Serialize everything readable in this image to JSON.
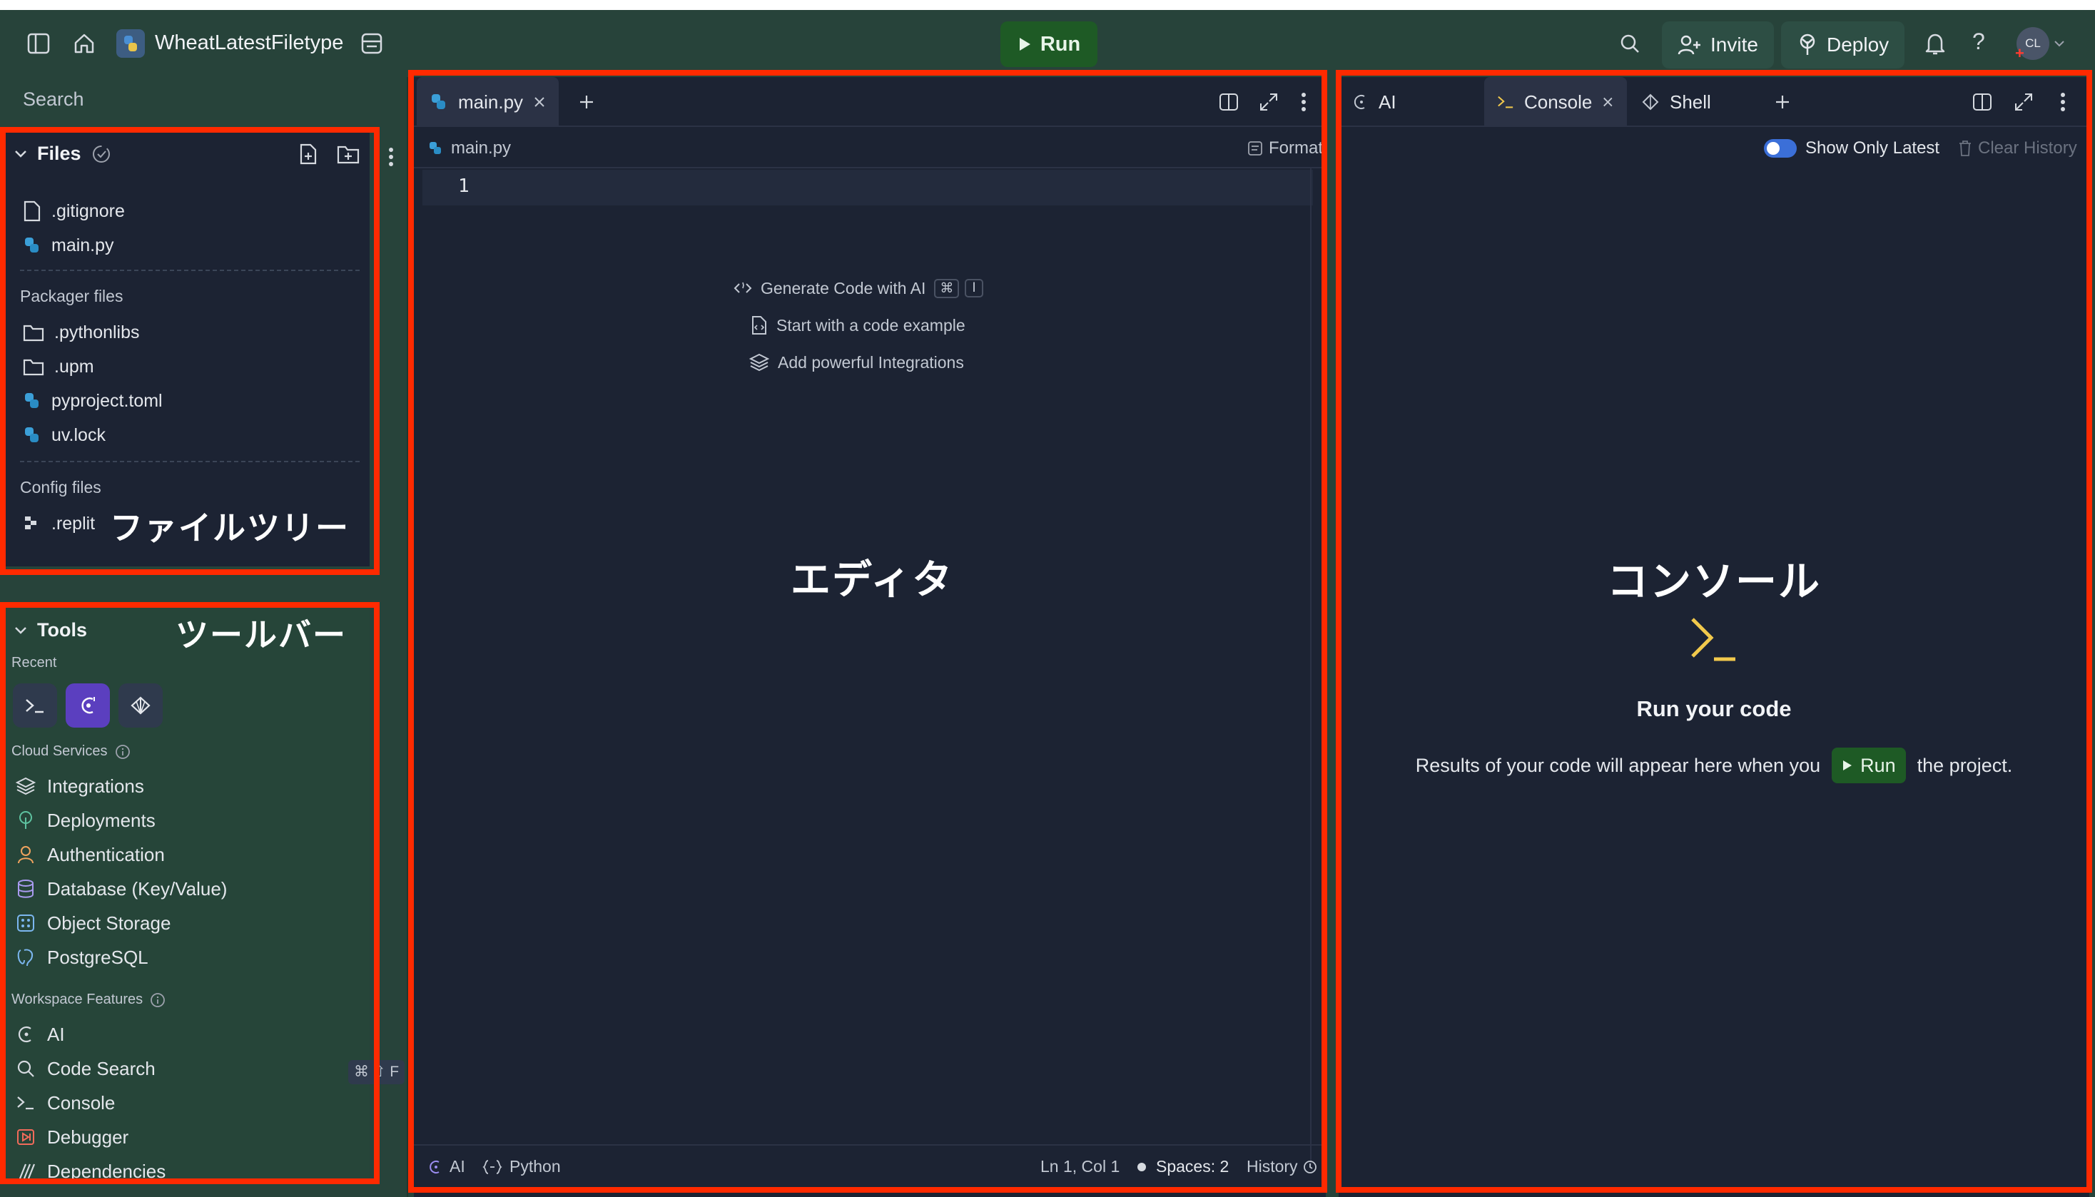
{
  "topbar": {
    "project_name": "WheatLatestFiletype",
    "run_label": "Run",
    "invite_label": "Invite",
    "deploy_label": "Deploy",
    "avatar_initials": "CL",
    "help_label": "?"
  },
  "sidebar": {
    "search_placeholder": "Search",
    "files_title": "Files",
    "files": [
      ".gitignore",
      "main.py"
    ],
    "packager_label": "Packager files",
    "packager_files": [
      ".pythonlibs",
      ".upm",
      "pyproject.toml",
      "uv.lock"
    ],
    "config_label": "Config files",
    "config_files": [
      ".replit"
    ],
    "files_annotation": "ファイルツリー",
    "tools_title": "Tools",
    "tools_annotation": "ツールバー",
    "recent_label": "Recent",
    "cloud_label": "Cloud Services",
    "cloud_items": [
      "Integrations",
      "Deployments",
      "Authentication",
      "Database (Key/Value)",
      "Object Storage",
      "PostgreSQL"
    ],
    "workspace_label": "Workspace Features",
    "workspace_items": [
      "AI",
      "Code Search",
      "Console",
      "Debugger",
      "Dependencies"
    ],
    "code_search_shortcut": "⌘ ⇧ F"
  },
  "editor": {
    "tab_label": "main.py",
    "breadcrumb": "main.py",
    "format_label": "Format",
    "line_number": "1",
    "hints": [
      "Generate Code with AI",
      "Start with a code example",
      "Add powerful Integrations"
    ],
    "hint_keys": [
      "⌘",
      "I"
    ],
    "annotation": "エディタ",
    "status": {
      "ai": "AI",
      "language": "Python",
      "cursor": "Ln 1, Col 1",
      "spaces": "Spaces: 2",
      "history": "History"
    }
  },
  "console": {
    "tabs": [
      "AI",
      "Console",
      "Shell"
    ],
    "show_only_latest": "Show Only Latest",
    "clear_history": "Clear History",
    "annotation": "コンソール",
    "prompt_glyph": ">_",
    "heading": "Run your code",
    "msg_before": "Results of your code will appear here when you",
    "run_label": "Run",
    "msg_after": "the project."
  },
  "colors": {
    "accent_green": "#1e5a25",
    "annotation_red": "#ff2a00",
    "panel_bg": "#1c2333",
    "app_bg": "#27433a"
  }
}
